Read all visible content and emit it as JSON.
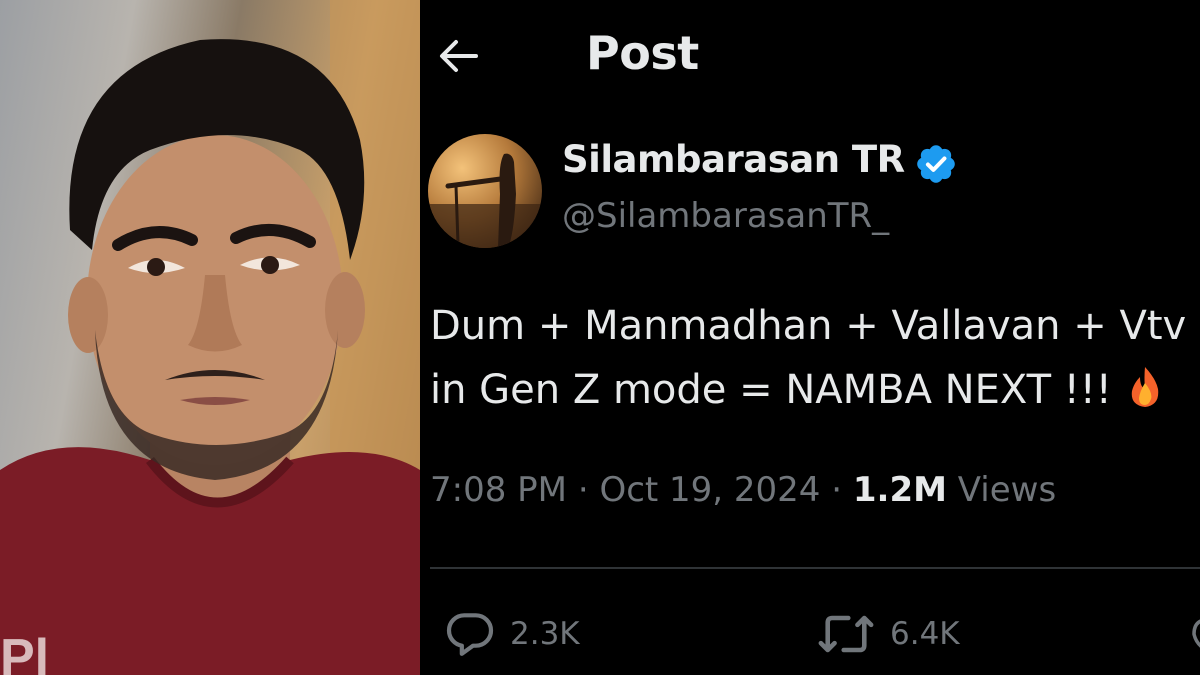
{
  "photo": {
    "shirt_letters": "Pl"
  },
  "header": {
    "back_icon": "arrow-left-icon",
    "title": "Post"
  },
  "post": {
    "author": {
      "display_name": "Silambarasan TR",
      "handle": "@SilambarasanTR_",
      "verified": true,
      "verified_color": "#1d9bf0"
    },
    "text_lines": [
      "Dum + Manmadhan + Vallavan + Vtv",
      "in Gen Z mode =  NAMBA NEXT !!!"
    ],
    "emoji": "fire-icon",
    "time": "7:08 PM",
    "separator": "·",
    "date": "Oct 19, 2024",
    "views_count": "1.2M",
    "views_label": "Views"
  },
  "actions": {
    "replies": {
      "icon": "reply-icon",
      "count": "2.3K"
    },
    "reposts": {
      "icon": "repost-icon",
      "count": "6.4K"
    }
  },
  "colors": {
    "background": "#000000",
    "text_primary": "#e7e9ea",
    "text_secondary": "#71767b",
    "divider": "#2f3336",
    "shirt": "#7b1c26"
  }
}
